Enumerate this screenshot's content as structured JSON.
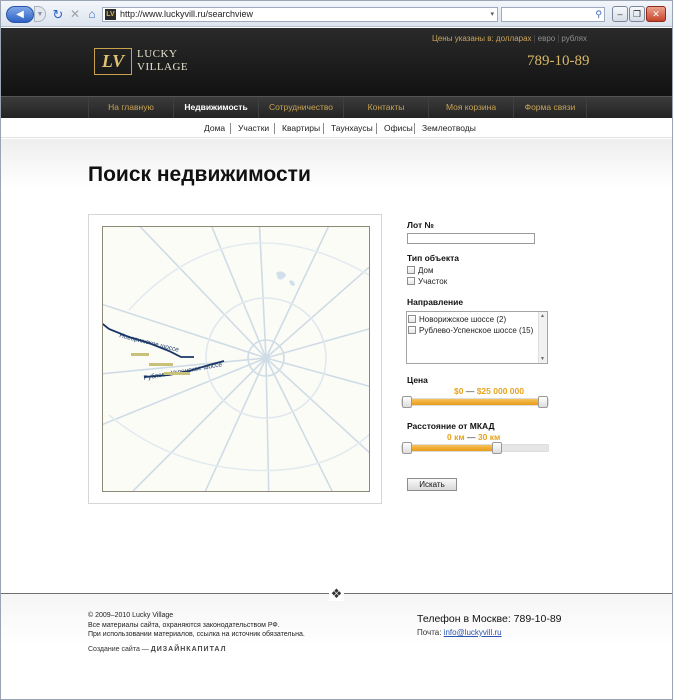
{
  "browser": {
    "url": "http://www.luckyvill.ru/searchview",
    "favicon": "LV",
    "icons": {
      "back": "back-arrow-icon",
      "forward": "forward-arrow-icon",
      "refresh": "refresh-icon",
      "stop": "stop-icon",
      "home": "home-icon",
      "search": "magnifier-icon"
    }
  },
  "header": {
    "logo_mark": "LV",
    "logo_line1": "LUCKY",
    "logo_line2": "VILLAGE",
    "currency_label": "Цены указаны в: долларах",
    "currency_opt1": "евро",
    "currency_opt2": "рублях",
    "phone": "789-10-89"
  },
  "mainnav": [
    "На главную",
    "Недвижимость",
    "Сотрудничество",
    "Контакты",
    "Моя корзина",
    "Форма связи"
  ],
  "mainnav_active": "Недвижимость",
  "subnav": [
    "Дома",
    "Участки",
    "Квартиры",
    "Таунхаусы",
    "Офисы",
    "Землеотводы"
  ],
  "page": {
    "title": "Поиск недвижимости"
  },
  "map": {
    "roads": [
      "Новорижское шоссе",
      "Рублево-Успенское шоссе"
    ],
    "highlight_color": "#1a3766"
  },
  "form": {
    "lot_label": "Лот №",
    "lot_value": "",
    "type_label": "Тип объекта",
    "types": [
      "Дом",
      "Участок"
    ],
    "direction_label": "Направление",
    "directions": [
      "Новорижское шоссе (2)",
      "Рублево-Успенское шоссе (15)"
    ],
    "price_label": "Цена",
    "price_min": "$0",
    "price_max": "$25 000 000",
    "price_fill": [
      0,
      1
    ],
    "dist_label": "Расстояние от МКАД",
    "dist_min": "0 км",
    "dist_max": "30 км",
    "dist_fill": [
      0,
      0.66
    ],
    "submit": "Искать",
    "accent": "#e7a21e"
  },
  "footer": {
    "copyright": "© 2009–2010 Lucky Village",
    "rights": "Все материалы сайта, охраняются законодательством РФ.",
    "note": "При использовании материалов, ссылка на источник обязательна.",
    "credit_prefix": "Создание сайта —",
    "credit_brand": "ДИЗАЙНКАПИТАЛ",
    "phone_line": "Телефон в Москве: 789-10-89",
    "mail_label": "Почта:",
    "mail": "info@luckyvill.ru"
  }
}
